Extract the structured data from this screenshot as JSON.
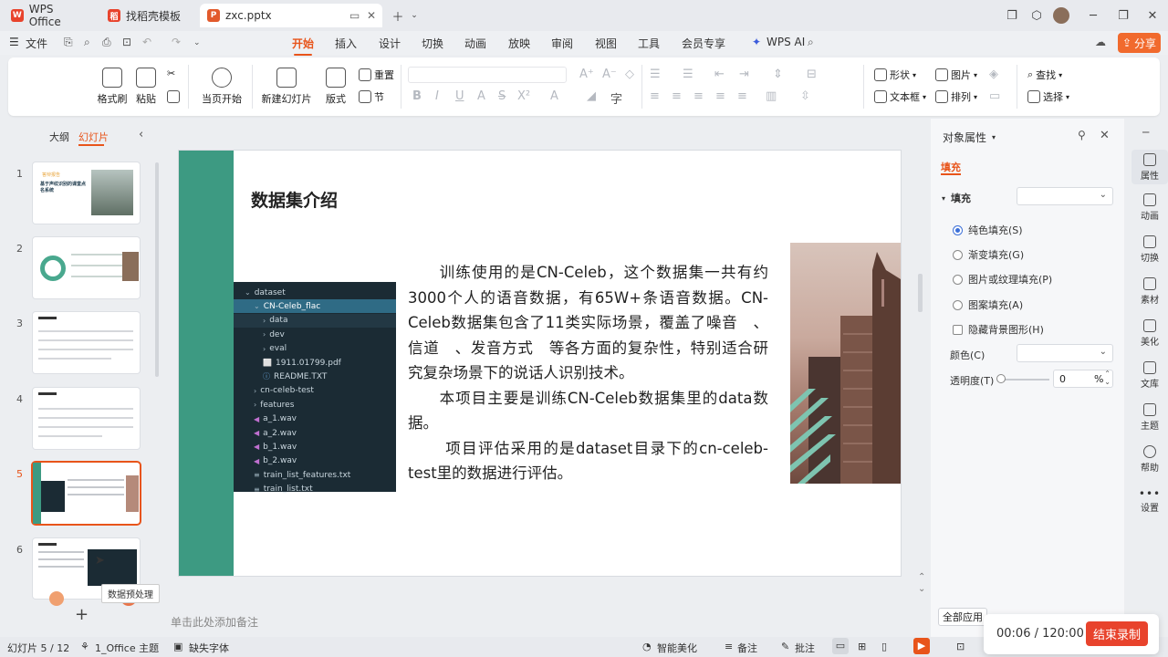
{
  "tabs": [
    {
      "label": "WPS Office",
      "logo": "W",
      "color": "#e8432c"
    },
    {
      "label": "找稻壳模板",
      "logo": "稻",
      "color": "#e8432c"
    },
    {
      "label": "zxc.pptx",
      "logo": "P",
      "color": "#e25a2c"
    }
  ],
  "menu": {
    "file": "文件",
    "items": [
      "开始",
      "插入",
      "设计",
      "切换",
      "动画",
      "放映",
      "审阅",
      "视图",
      "工具",
      "会员专享"
    ],
    "active": "开始",
    "wps_ai": "WPS AI",
    "share": "分享"
  },
  "ribbon": {
    "format_painter": "格式刷",
    "paste": "粘贴",
    "play_current": "当页开始",
    "new_slide": "新建幻灯片",
    "layout": "版式",
    "reset": "重置",
    "section": "节",
    "shape": "形状",
    "image": "图片",
    "textbox": "文本框",
    "arrange": "排列",
    "find": "查找",
    "select": "选择"
  },
  "left_panel": {
    "outline_tab": "大纲",
    "slides_tab": "幻灯片",
    "slide_numbers": [
      "1",
      "2",
      "3",
      "4",
      "5",
      "6"
    ],
    "selected": "5",
    "add": "+",
    "tooltip": "数据预处理",
    "thumb1_title": "基于声纹识别的课堂点名系统",
    "thumb1_tag": "答辩报告"
  },
  "slide": {
    "title": "数据集介绍",
    "paragraphs": [
      "训练使用的是CN-Celeb，这个数据集一共有约3000个人的语音数据，有65W+条语音数据。CN-Celeb数据集包含了11类实际场景，覆盖了噪音　、信道　、发音方式　等各方面的复杂性，特别适合研究复杂场景下的说话人识别技术。",
      "本项目主要是训练CN-Celeb数据集里的data数据。",
      "项目评估采用的是dataset目录下的cn-celeb-test里的数据进行评估。"
    ],
    "tree": [
      {
        "label": "dataset",
        "indent": 0,
        "icon": "⌄",
        "style": ""
      },
      {
        "label": "CN-Celeb_flac",
        "indent": 1,
        "icon": "⌄",
        "style": "hl"
      },
      {
        "label": "data",
        "indent": 2,
        "icon": "›",
        "style": "sub"
      },
      {
        "label": "dev",
        "indent": 2,
        "icon": "›",
        "style": ""
      },
      {
        "label": "eval",
        "indent": 2,
        "icon": "›",
        "style": ""
      },
      {
        "label": "1911.01799.pdf",
        "indent": 2,
        "icon": "⬜",
        "style": ""
      },
      {
        "label": "README.TXT",
        "indent": 2,
        "icon": "ⓘ",
        "style": ""
      },
      {
        "label": "cn-celeb-test",
        "indent": 1,
        "icon": "›",
        "style": ""
      },
      {
        "label": "features",
        "indent": 1,
        "icon": "›",
        "style": ""
      },
      {
        "label": "a_1.wav",
        "indent": 1,
        "icon": "◀",
        "style": ""
      },
      {
        "label": "a_2.wav",
        "indent": 1,
        "icon": "◀",
        "style": ""
      },
      {
        "label": "b_1.wav",
        "indent": 1,
        "icon": "◀",
        "style": ""
      },
      {
        "label": "b_2.wav",
        "indent": 1,
        "icon": "◀",
        "style": ""
      },
      {
        "label": "train_list_features.txt",
        "indent": 1,
        "icon": "≡",
        "style": ""
      },
      {
        "label": "train_list.txt",
        "indent": 1,
        "icon": "≡",
        "style": ""
      }
    ]
  },
  "notes_placeholder": "单击此处添加备注",
  "status": {
    "slide_count": "幻灯片 5 / 12",
    "theme": "1_Office 主题",
    "missing_font": "缺失字体",
    "beautify": "智能美化",
    "notes": "备注",
    "comment": "批注"
  },
  "right_panel": {
    "title": "对象属性",
    "tab_fill": "填充",
    "section_fill": "填充",
    "options": [
      {
        "label": "纯色填充(S)",
        "type": "radio",
        "checked": true
      },
      {
        "label": "渐变填充(G)",
        "type": "radio",
        "checked": false
      },
      {
        "label": "图片或纹理填充(P)",
        "type": "radio",
        "checked": false
      },
      {
        "label": "图案填充(A)",
        "type": "radio",
        "checked": false
      },
      {
        "label": "隐藏背景图形(H)",
        "type": "checkbox",
        "checked": false
      }
    ],
    "color_label": "颜色(C)",
    "transparency_label": "透明度(T)",
    "transparency_value": "0",
    "transparency_unit": "%",
    "apply_all": "全部应用"
  },
  "rail": [
    "属性",
    "动画",
    "切换",
    "素材",
    "美化",
    "文库",
    "主题",
    "帮助",
    "设置"
  ],
  "recorder": {
    "time": "00:06 / 120:00",
    "stop": "结束录制"
  }
}
